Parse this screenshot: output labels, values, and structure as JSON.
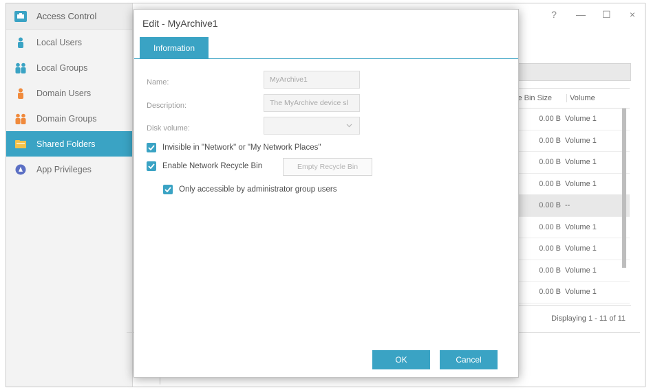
{
  "colors": {
    "accent": "#3aa3c4",
    "sidebar_bg": "#f3f3f3"
  },
  "window": {
    "title": "Access Control",
    "controls": {
      "help": "?",
      "minimize": "—",
      "maximize": "☐",
      "close": "×"
    }
  },
  "sidebar": {
    "items": [
      {
        "label": "Local Users",
        "icon": "user-icon"
      },
      {
        "label": "Local Groups",
        "icon": "group-icon"
      },
      {
        "label": "Domain Users",
        "icon": "domain-user-icon"
      },
      {
        "label": "Domain Groups",
        "icon": "domain-group-icon"
      },
      {
        "label": "Shared Folders",
        "icon": "folder-icon",
        "active": true
      },
      {
        "label": "App Privileges",
        "icon": "app-icon"
      }
    ]
  },
  "background_table": {
    "headers": {
      "size": "ycle Bin Size",
      "volume": "Volume"
    },
    "rows": [
      {
        "size": "0.00 B",
        "volume": "Volume 1"
      },
      {
        "size": "0.00 B",
        "volume": "Volume 1"
      },
      {
        "size": "0.00 B",
        "volume": "Volume 1"
      },
      {
        "size": "0.00 B",
        "volume": "Volume 1"
      },
      {
        "size": "0.00 B",
        "volume": "--"
      },
      {
        "size": "0.00 B",
        "volume": "Volume 1"
      },
      {
        "size": "0.00 B",
        "volume": "Volume 1"
      },
      {
        "size": "0.00 B",
        "volume": "Volume 1"
      },
      {
        "size": "0.00 B",
        "volume": "Volume 1"
      }
    ],
    "footer": "Displaying 1 - 11 of 11"
  },
  "dialog": {
    "title": "Edit - MyArchive1",
    "tab": "Information",
    "name_label": "Name:",
    "name_value": "MyArchive1",
    "description_label": "Description:",
    "description_value": "The MyArchive device sl",
    "disk_volume_label": "Disk volume:",
    "disk_volume_value": "",
    "invisible_label": "Invisible in \"Network\" or \"My Network Places\"",
    "recycle_label": "Enable Network Recycle Bin",
    "empty_recycle_button": "Empty Recycle Bin",
    "admin_only_label": "Only accessible by administrator group users",
    "ok_button": "OK",
    "cancel_button": "Cancel"
  }
}
